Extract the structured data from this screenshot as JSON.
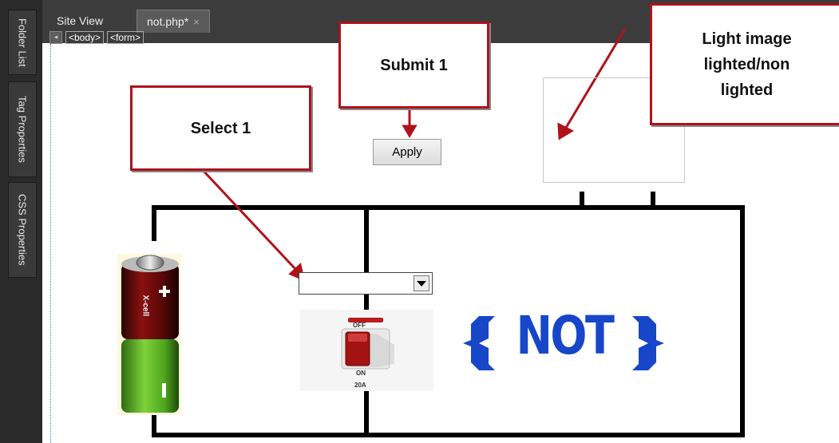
{
  "sidebar": {
    "tabs": [
      {
        "label": "Folder List"
      },
      {
        "label": "Tag Properties"
      },
      {
        "label": "CSS Properties"
      }
    ]
  },
  "tabs": [
    {
      "label": "Site View"
    },
    {
      "label": "not.php*",
      "close": "×"
    }
  ],
  "breadcrumb": {
    "items": [
      "<body>",
      "<form>"
    ],
    "nav": "◂"
  },
  "form": {
    "apply_label": "Apply",
    "select_value": ""
  },
  "callouts": {
    "submit": "Submit 1",
    "select": "Select 1",
    "light_line1": "Light image",
    "light_line2": "lighted/non",
    "light_line3": "lighted"
  },
  "battery": {
    "brand": "X-cell",
    "plus": "+",
    "minus": "I"
  },
  "switch": {
    "off": "OFF",
    "on": "ON",
    "rating": "20A"
  },
  "gate": {
    "label": "NOT"
  },
  "colors": {
    "callout_border": "#b0121b",
    "gate_blue": "#1746c9",
    "wire": "#000000"
  }
}
